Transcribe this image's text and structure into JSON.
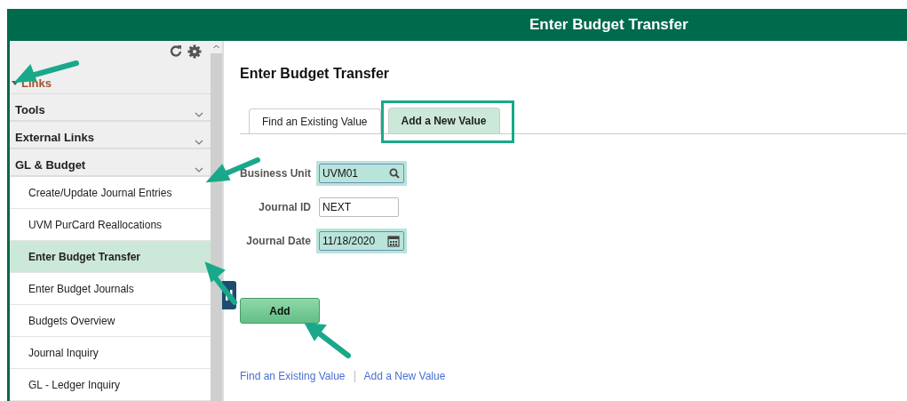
{
  "header": {
    "title": "Enter Budget Transfer"
  },
  "sidebar": {
    "section": {
      "label": "Links",
      "expanded": true
    },
    "groups": [
      {
        "label": "Tools"
      },
      {
        "label": "External Links"
      },
      {
        "label": "GL & Budget"
      }
    ],
    "items": [
      {
        "label": "Create/Update Journal Entries",
        "selected": false
      },
      {
        "label": "UVM PurCard Reallocations",
        "selected": false
      },
      {
        "label": "Enter Budget Transfer",
        "selected": true
      },
      {
        "label": "Enter Budget Journals",
        "selected": false
      },
      {
        "label": "Budgets Overview",
        "selected": false
      },
      {
        "label": "Journal Inquiry",
        "selected": false
      },
      {
        "label": "GL - Ledger Inquiry",
        "selected": false
      }
    ]
  },
  "page": {
    "title": "Enter Budget Transfer",
    "tabs": [
      {
        "label": "Find an Existing Value",
        "selected": false
      },
      {
        "label": "Add a New Value",
        "selected": true
      }
    ],
    "fields": [
      {
        "kind": "lookup",
        "label": "Business Unit",
        "value": "UVM01",
        "highlighted": true
      },
      {
        "kind": "text",
        "label": "Journal ID",
        "value": "NEXT",
        "highlighted": false
      },
      {
        "kind": "date",
        "label": "Journal Date",
        "value": "11/18/2020",
        "highlighted": true
      }
    ],
    "add_button": "Add",
    "links": [
      {
        "label": "Find an Existing Value"
      },
      {
        "label": "Add a New Value"
      }
    ]
  }
}
